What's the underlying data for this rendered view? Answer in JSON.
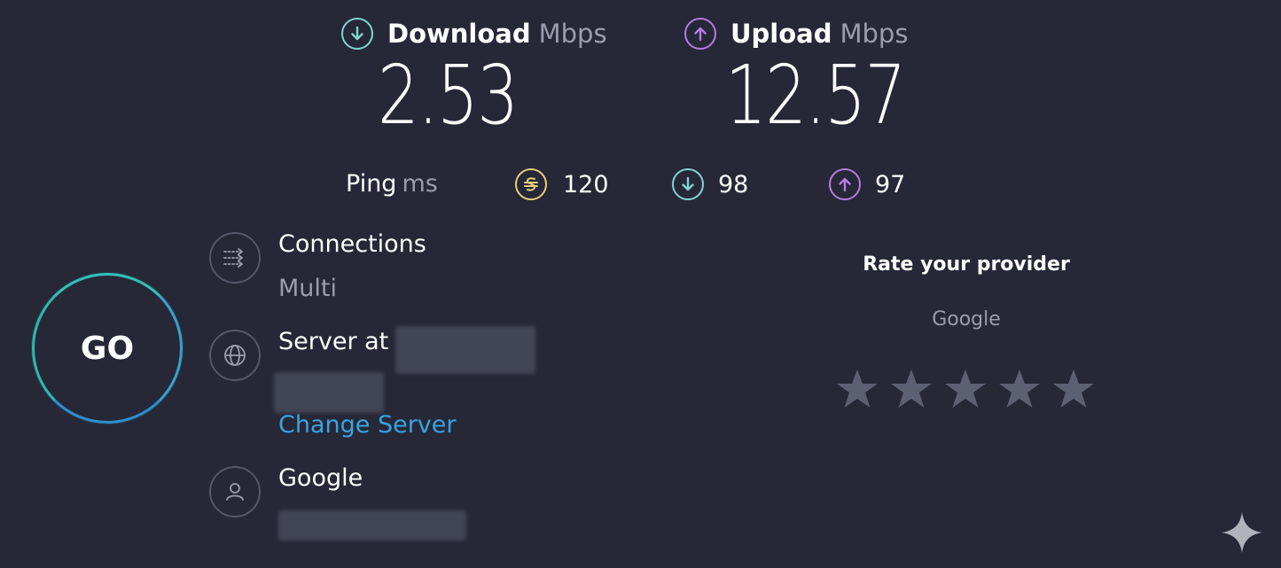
{
  "download": {
    "label": "Download",
    "unit": "Mbps",
    "value": "2.53"
  },
  "upload": {
    "label": "Upload",
    "unit": "Mbps",
    "value": "12.57"
  },
  "ping": {
    "label": "Ping",
    "unit": "ms",
    "idle": "120",
    "download": "98",
    "upload": "97"
  },
  "go_button": {
    "label": "GO"
  },
  "connections": {
    "title": "Connections",
    "value": "Multi"
  },
  "server": {
    "title": "Server at",
    "change_label": "Change Server"
  },
  "isp": {
    "name": "Google"
  },
  "rating": {
    "title": "Rate your provider",
    "provider": "Google",
    "stars": 5
  },
  "icons": {
    "download": "arrow-down-circle-icon",
    "upload": "arrow-up-circle-icon",
    "idle": "ping-idle-icon",
    "connections": "connections-icon",
    "server": "globe-icon",
    "user": "user-icon",
    "sparkle": "sparkle-icon",
    "star": "star-icon"
  },
  "colors": {
    "background": "#262838",
    "download_accent": "#7fd6d0",
    "upload_accent": "#b57cdf",
    "ping_idle": "#e6cf7a",
    "go_ring": "#2fb6b2",
    "link": "#3aa3e0",
    "muted_text": "#9b9cae",
    "star": "#5d5f73"
  }
}
